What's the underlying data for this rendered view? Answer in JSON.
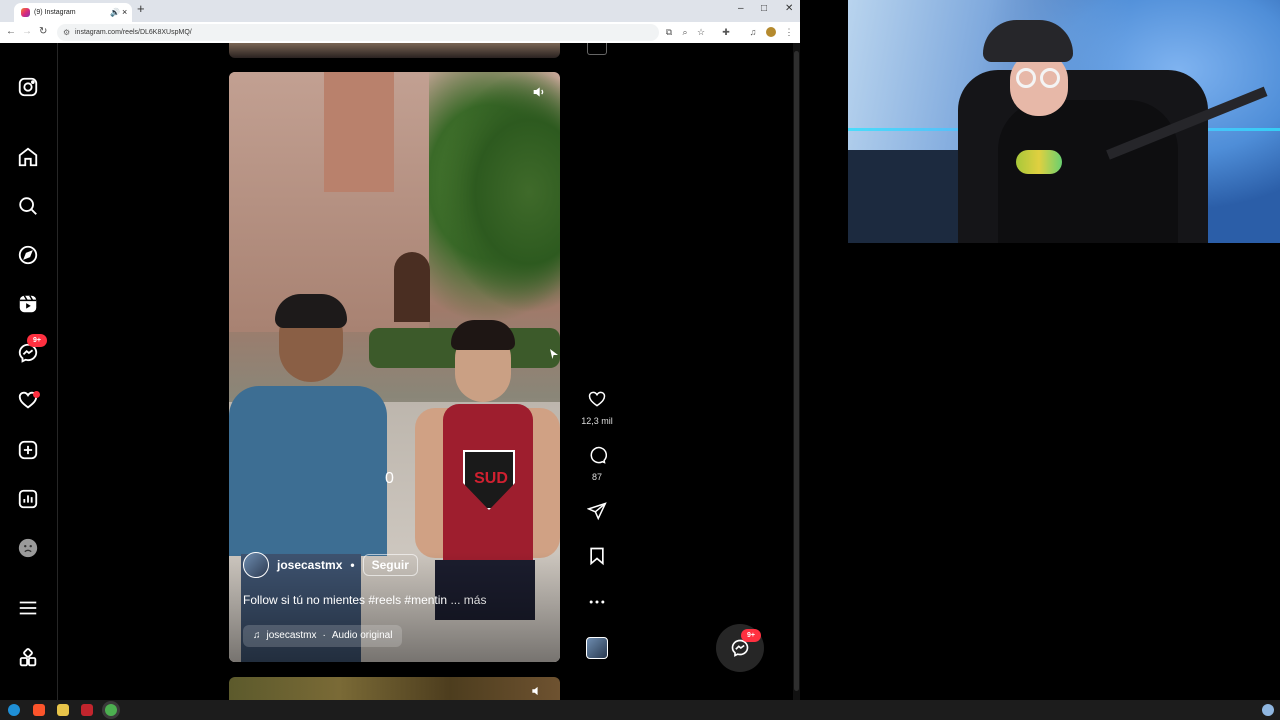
{
  "browser": {
    "tab_title": "(9) Instagram",
    "url": "instagram.com/reels/DL6K8XUspMQ/",
    "new_tab_label": "+",
    "window_controls": [
      "–",
      "□",
      "✕"
    ]
  },
  "sidebar": {
    "items": [
      {
        "name": "instagram-logo",
        "icon": "instagram-icon"
      },
      {
        "name": "home",
        "icon": "home-icon"
      },
      {
        "name": "search",
        "icon": "search-icon"
      },
      {
        "name": "explore",
        "icon": "compass-icon"
      },
      {
        "name": "reels",
        "icon": "reels-icon"
      },
      {
        "name": "messages",
        "icon": "messenger-icon",
        "badge": "9+"
      },
      {
        "name": "notifications",
        "icon": "heart-icon"
      },
      {
        "name": "create",
        "icon": "plus-square-icon"
      },
      {
        "name": "dashboard",
        "icon": "chart-icon"
      },
      {
        "name": "profile",
        "icon": "avatar-icon"
      },
      {
        "name": "more",
        "icon": "menu-icon"
      },
      {
        "name": "also-from-meta",
        "icon": "grid-icon"
      }
    ]
  },
  "reel": {
    "shirt_text": "SUD",
    "play_marker": "0",
    "author": "josecastmx",
    "separator": "•",
    "follow_label": "Seguir",
    "caption": "Follow si tú no mientes #reels #mentin",
    "caption_more": "... más",
    "audio_author": "josecastmx",
    "audio_label": "Audio original"
  },
  "actions": {
    "likes": "12,3 mil",
    "comments": "87"
  },
  "messages_fab": {
    "badge": "9+"
  },
  "colors": {
    "accent_red": "#ff3040",
    "background": "#000000"
  }
}
